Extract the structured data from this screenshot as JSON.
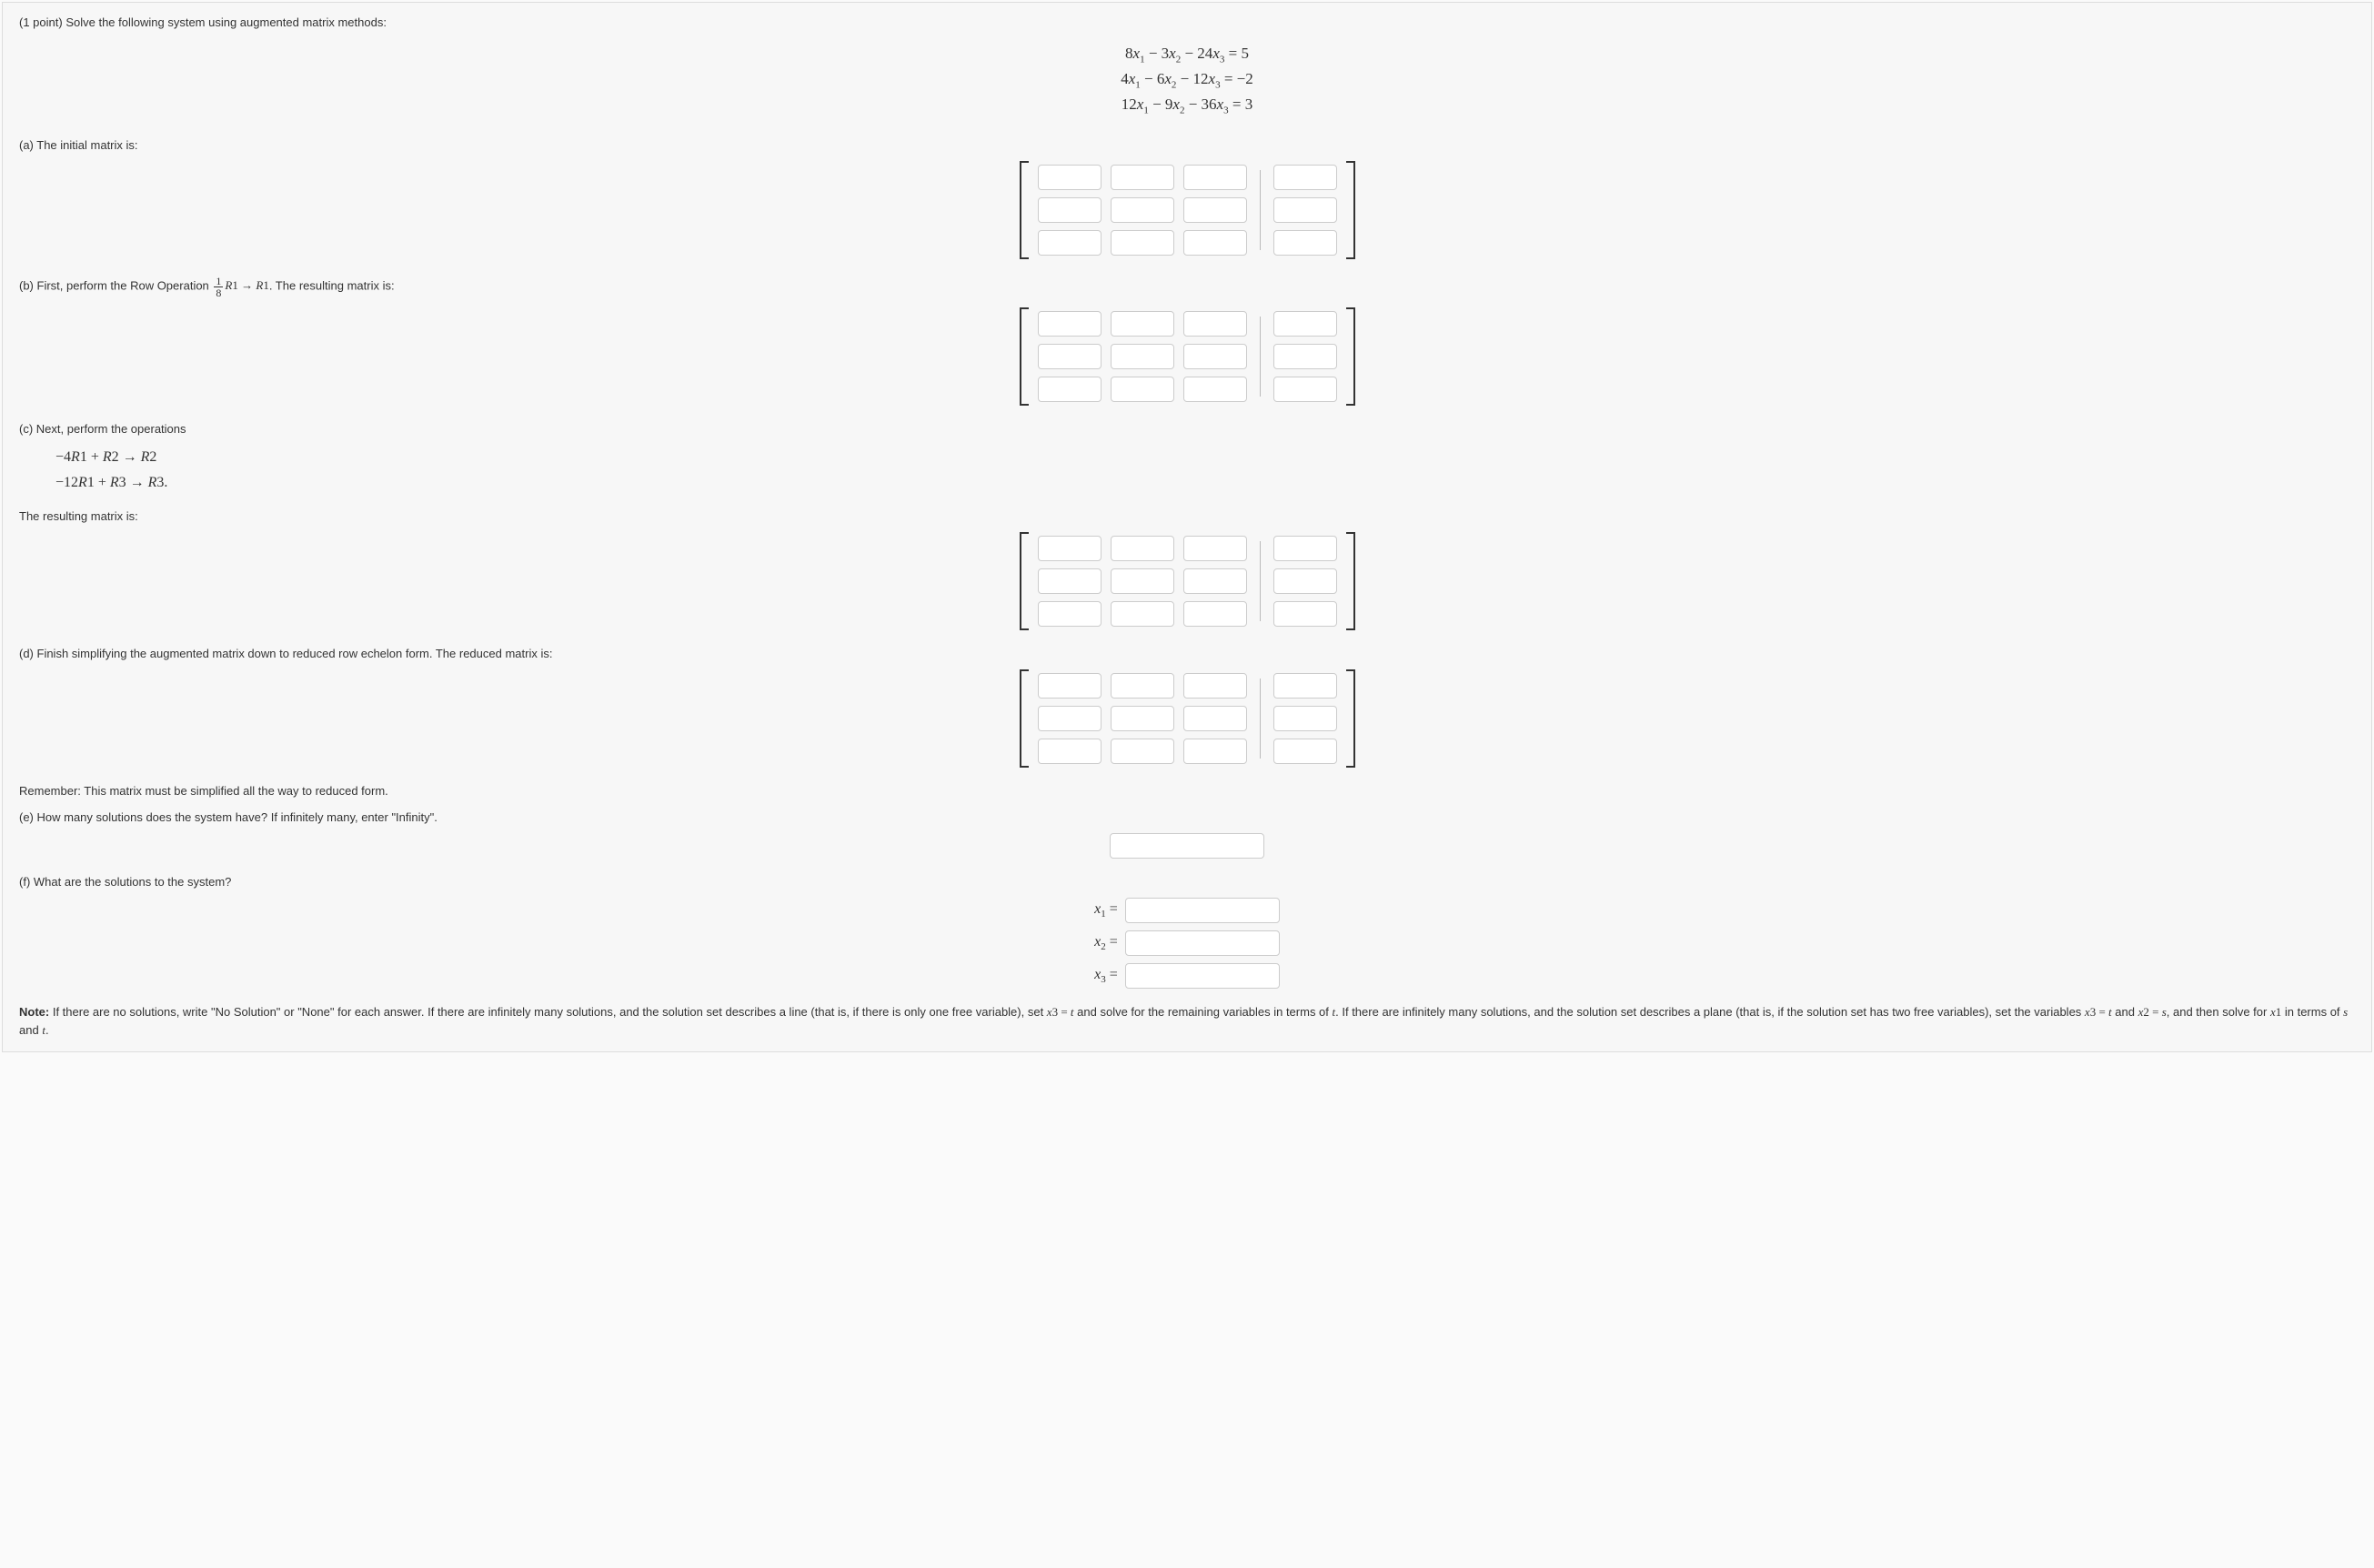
{
  "problem": {
    "points": "(1 point)",
    "prompt": "Solve the following system using augmented matrix methods:",
    "equations": [
      "8x₁ − 3x₂ − 24x₃ = 5",
      "4x₁ − 6x₂ − 12x₃ = −2",
      "12x₁ − 9x₂ − 36x₃ = 3"
    ]
  },
  "parts": {
    "a": {
      "label": "(a) The initial matrix is:"
    },
    "b": {
      "label_prefix": "(b) First, perform the Row Operation ",
      "op_fraction_num": "1",
      "op_fraction_den": "8",
      "op_rest": "R₁ → R₁",
      "label_suffix": ". The resulting matrix is:"
    },
    "c": {
      "label_intro": "(c) Next, perform the operations",
      "op1": "−4R₁ + R₂ → R₂",
      "op2": "−12R₁ + R₃ → R₃.",
      "label_result": "The resulting matrix is:"
    },
    "d": {
      "label": "(d) Finish simplifying the augmented matrix down to reduced row echelon form. The reduced matrix is:",
      "reminder": "Remember: This matrix must be simplified all the way to reduced form."
    },
    "e": {
      "label": "(e) How many solutions does the system have? If infinitely many, enter \"Infinity\"."
    },
    "f": {
      "label": "(f) What are the solutions to the system?",
      "vars": [
        "x₁ =",
        "x₂ =",
        "x₃ ="
      ]
    }
  },
  "note": {
    "bold": "Note:",
    "text": " If there are no solutions, write \"No Solution\" or \"None\" for each answer. If there are infinitely many solutions, and the solution set describes a line (that is, if there is only one free variable), set x₃ = t and solve for the remaining variables in terms of t. If there are infinitely many solutions, and the solution set describes a plane (that is, if the solution set has two free variables), set the variables x₃ = t and x₂ = s, and then solve for x₁ in terms of s and t."
  },
  "chart_data": {
    "type": "table",
    "description": "System of linear equations coefficients",
    "headers": [
      "x1",
      "x2",
      "x3",
      "="
    ],
    "rows": [
      [
        8,
        -3,
        -24,
        5
      ],
      [
        4,
        -6,
        -12,
        -2
      ],
      [
        12,
        -9,
        -36,
        3
      ]
    ]
  }
}
